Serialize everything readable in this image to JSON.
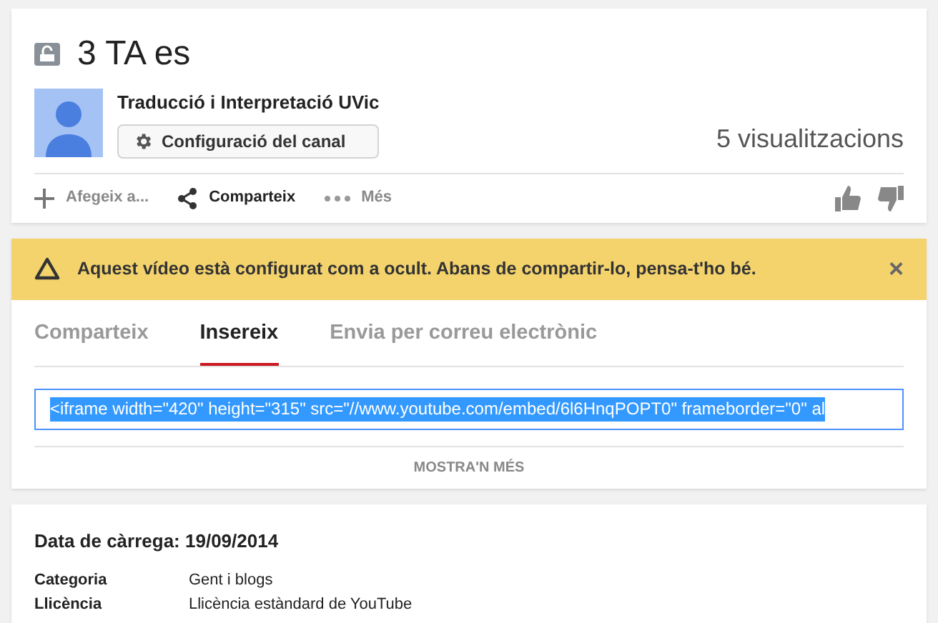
{
  "video": {
    "title": "3 TA es",
    "channel": "Traducció i Interpretació UVic",
    "channel_button": "Configuració del canal",
    "views": "5 visualitzacions"
  },
  "actions": [
    {
      "label": "Afegeix a...",
      "active": false
    },
    {
      "label": "Comparteix",
      "active": true
    },
    {
      "label": "Més",
      "active": false
    }
  ],
  "warning": {
    "text": "Aquest vídeo està configurat com a ocult. Abans de compartir-lo, pensa-t'ho bé.",
    "close": "×"
  },
  "tabs": [
    {
      "label": "Comparteix",
      "selected": false
    },
    {
      "label": "Insereix",
      "selected": true
    },
    {
      "label": "Envia per correu electrònic",
      "selected": false
    }
  ],
  "embed_code": "<iframe width=\"420\" height=\"315\" src=\"//www.youtube.com/embed/6l6HnqPOPT0\" frameborder=\"0\" al",
  "show_more": "MOSTRA'N MÉS",
  "details": {
    "upload_date": "Data de càrrega: 19/09/2014",
    "rows": [
      {
        "label": "Categoria",
        "value": "Gent i blogs"
      },
      {
        "label": "Llicència",
        "value": "Llicència estàndard de YouTube"
      }
    ]
  }
}
